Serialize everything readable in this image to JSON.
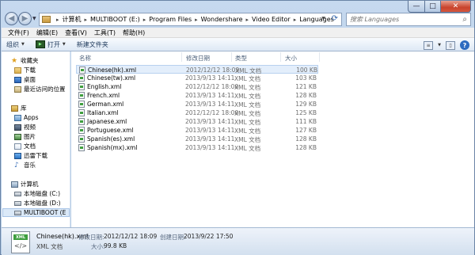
{
  "address": {
    "crumbs": [
      "计算机",
      "MULTIBOOT (E:)",
      "Program Files",
      "Wondershare",
      "Video Editor",
      "Languages"
    ]
  },
  "search": {
    "placeholder": "搜索 Languages"
  },
  "window_controls": {
    "minimize": "—",
    "maximize": "□",
    "close": "✕"
  },
  "menu": [
    "文件(F)",
    "编辑(E)",
    "查看(V)",
    "工具(T)",
    "帮助(H)"
  ],
  "toolbar": {
    "organize": "组织",
    "open": "打开",
    "new_folder": "新建文件夹"
  },
  "sidebar": {
    "favorites": "收藏夹",
    "downloads": "下载",
    "desktop": "桌面",
    "recent": "最近访问的位置",
    "libraries": "库",
    "apps": "Apps",
    "videos": "视频",
    "pictures": "图片",
    "documents": "文档",
    "xunlei": "迅雷下载",
    "music": "音乐",
    "computer": "计算机",
    "drive_c": "本地磁盘 (C:)",
    "drive_d": "本地磁盘 (D:)",
    "drive_e": "MULTIBOOT (E"
  },
  "columns": {
    "name": "名称",
    "date": "修改日期",
    "type": "类型",
    "size": "大小"
  },
  "files": [
    {
      "name": "Chinese(hk).xml",
      "date": "2012/12/12 18:09",
      "type": "XML 文档",
      "size": "100 KB",
      "selected": true
    },
    {
      "name": "Chinese(tw).xml",
      "date": "2013/9/13 14:11",
      "type": "XML 文档",
      "size": "103 KB"
    },
    {
      "name": "English.xml",
      "date": "2012/12/12 18:00",
      "type": "XML 文档",
      "size": "121 KB"
    },
    {
      "name": "French.xml",
      "date": "2013/9/13 14:11",
      "type": "XML 文档",
      "size": "128 KB"
    },
    {
      "name": "German.xml",
      "date": "2013/9/13 14:11",
      "type": "XML 文档",
      "size": "129 KB"
    },
    {
      "name": "Italian.xml",
      "date": "2012/12/12 18:00",
      "type": "XML 文档",
      "size": "125 KB"
    },
    {
      "name": "Japanese.xml",
      "date": "2013/9/13 14:11",
      "type": "XML 文档",
      "size": "111 KB"
    },
    {
      "name": "Portuguese.xml",
      "date": "2013/9/13 14:11",
      "type": "XML 文档",
      "size": "127 KB"
    },
    {
      "name": "Spanish(es).xml",
      "date": "2013/9/13 14:11",
      "type": "XML 文档",
      "size": "128 KB"
    },
    {
      "name": "Spanish(mx).xml",
      "date": "2013/9/13 14:11",
      "type": "XML 文档",
      "size": "128 KB"
    }
  ],
  "details": {
    "name": "Chinese(hk).xml",
    "type": "XML 文档",
    "modified_label": "修改日期:",
    "modified_value": "2012/12/12 18:09",
    "created_label": "创建日期:",
    "created_value": "2013/9/22 17:50",
    "size_label": "大小:",
    "size_value": "99.8 KB",
    "icon_badge": "XML",
    "icon_code": "</>"
  }
}
